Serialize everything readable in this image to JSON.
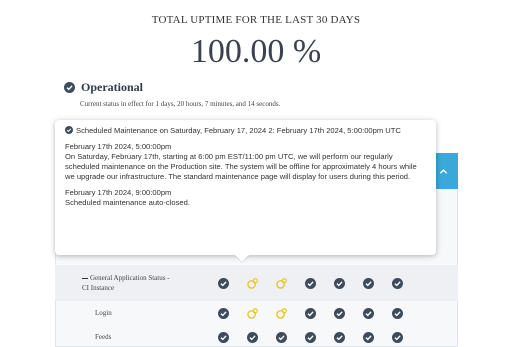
{
  "uptime": {
    "title": "TOTAL UPTIME FOR THE LAST 30 DAYS",
    "value": "100.00 %"
  },
  "status": {
    "icon": "check-circle-icon",
    "label": "Operational",
    "note": "Current status in effect for 1 days, 20 hours, 7 minutes, and 14 seconds."
  },
  "popover": {
    "icon": "check-circle-icon",
    "title": "Scheduled Maintenance on Saturday, February 17, 2024 2: February 17th 2024, 5:00:00pm UTC",
    "update1_date": "February 17th 2024, 5:00:00pm",
    "update1_text": "On Saturday, February 17th, starting at 6:00 pm EST/11:00 pm UTC, we will perform our regularly scheduled maintenance on the Production site. The system will be offline for approximately 4 hours while we upgrade our infrastructure. The standard maintenance page will display for users during this period.",
    "update2_date": "February 17th 2024, 9:00:00pm",
    "update2_text": "Scheduled maintenance auto-closed."
  },
  "collapse_icon": "chevron-up-icon",
  "colors": {
    "ok": "#3d4b5c",
    "maintenance": "#e8c21c",
    "accent": "#3aa8d8"
  },
  "components": [
    {
      "label": "General Application Status - CI Instance",
      "days": [
        "ok",
        "maintenance",
        "maintenance",
        "ok",
        "ok",
        "ok",
        "ok"
      ]
    },
    {
      "label": "Login",
      "days": [
        "ok",
        "maintenance",
        "maintenance",
        "ok",
        "ok",
        "ok",
        "ok"
      ]
    },
    {
      "label": "Feeds",
      "days": [
        "ok",
        "ok",
        "ok",
        "ok",
        "ok",
        "ok",
        "ok"
      ]
    }
  ]
}
